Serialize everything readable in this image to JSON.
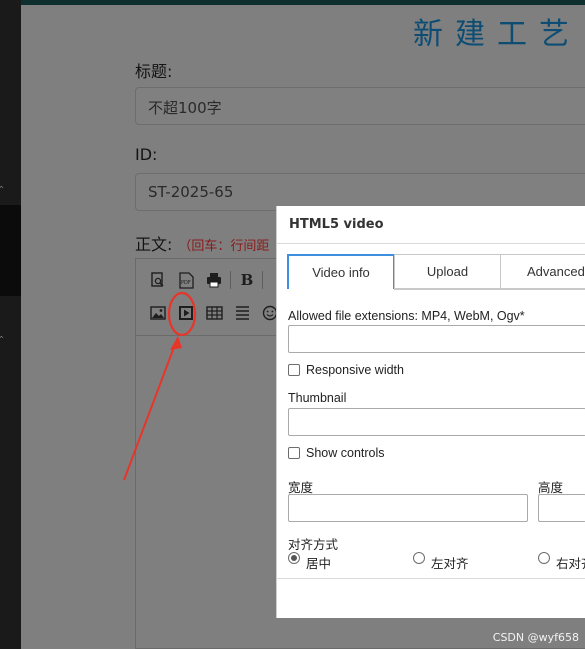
{
  "page": {
    "title": "新建工艺",
    "title_field_label": "标题:",
    "title_placeholder": "不超100字",
    "id_label": "ID:",
    "id_value": "ST-2025-65",
    "body_label": "正文:",
    "body_hint": "（回车：行间距"
  },
  "toolbar": {
    "row1": [
      "preview-icon",
      "pdf-icon",
      "print-icon",
      "bold-icon"
    ],
    "row2": [
      "image-icon",
      "video-icon",
      "table-icon",
      "align-icon",
      "emoji-icon"
    ],
    "bold_label": "B",
    "pdf_label": "PDF"
  },
  "dialog": {
    "title": "HTML5 video",
    "tabs": [
      "Video info",
      "Upload",
      "Advanced"
    ],
    "active_tab": "Video info",
    "url_label": "Allowed file extensions: MP4, WebM, Ogv*",
    "responsive_label": "Responsive width",
    "thumbnail_label": "Thumbnail",
    "controls_label": "Show controls",
    "width_label": "宽度",
    "height_label": "高度",
    "align_label": "对齐方式",
    "align_options": [
      "居中",
      "左对齐",
      "右对齐"
    ],
    "align_selected": "居中"
  },
  "watermark": "CSDN @wyf658",
  "colors": {
    "annotation": "#e8352a",
    "tab_active_border": "#3f8fe0",
    "title": "#0e4d73",
    "hint": "#8a1a1a"
  }
}
